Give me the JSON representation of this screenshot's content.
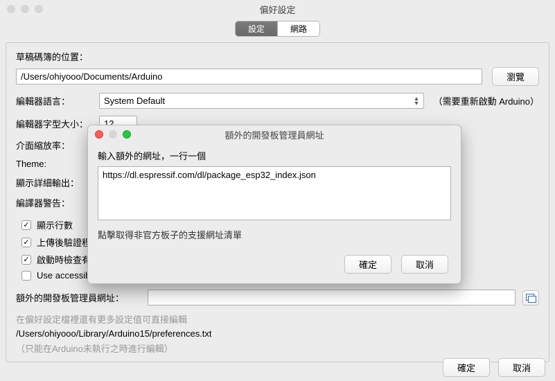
{
  "window": {
    "title": "偏好設定"
  },
  "tabs": {
    "settings": "設定",
    "network": "網路"
  },
  "prefs": {
    "sketchbook_label": "草稿碼簿的位置：",
    "sketchbook_path": "/Users/ohiyooo/Documents/Arduino",
    "browse_label": "瀏覽",
    "editor_lang_label": "編輯器語言：",
    "editor_lang_value": "System Default",
    "editor_lang_note": "（需要重新啟動 Arduino）",
    "font_size_label": "編輯器字型大小：",
    "font_size_value": "12",
    "scale_label": "介面縮放率：",
    "theme_label": "Theme:",
    "verbose_label": "顯示詳細輸出：",
    "compiler_warn_label": "編譯器警告：",
    "checkbox": {
      "line_numbers": "顯示行數",
      "verify_upload": "上傳後驗證程",
      "check_update": "啟動時檢查有",
      "a11y": "Use accessibility features"
    },
    "extra_urls_label": "額外的開發板管理員網址：",
    "footer_more": "在偏好設定檔裡還有更多設定值可直接編輯",
    "footer_path": "/Users/ohiyooo/Library/Arduino15/preferences.txt",
    "footer_note": "（只能在Arduino未執行之時進行編輯）"
  },
  "buttons": {
    "ok": "確定",
    "cancel": "取消"
  },
  "modal": {
    "title": "額外的開發板管理員網址",
    "instruction": "輸入額外的網址，一行一個",
    "urls": "https://dl.espressif.com/dl/package_esp32_index.json",
    "link_text": "點擊取得非官方板子的支援網址清單",
    "ok": "確定",
    "cancel": "取消"
  }
}
